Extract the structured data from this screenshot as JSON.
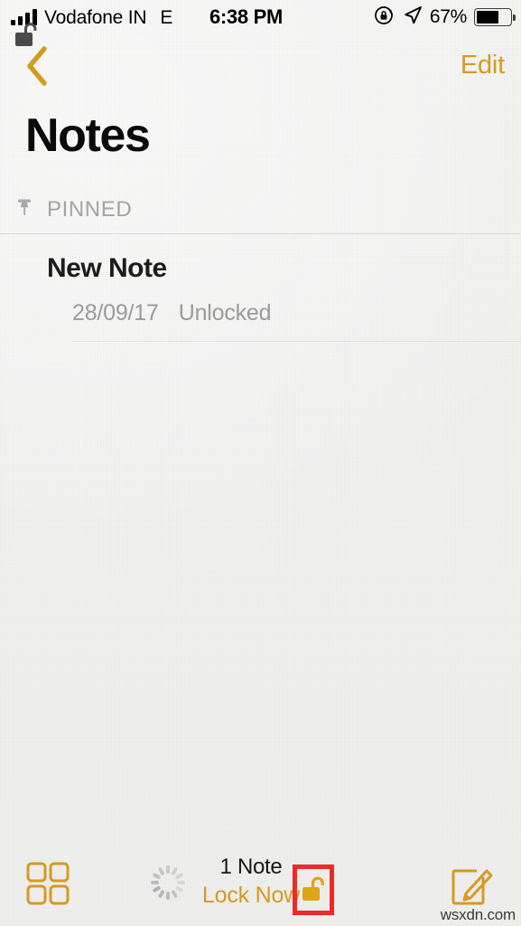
{
  "status_bar": {
    "carrier": "Vodafone IN",
    "network_type": "E",
    "signal_bars": 4,
    "time": "6:38 PM",
    "battery_percent": "67%",
    "battery_level": 67,
    "icons": [
      "signal-bars-icon",
      "rotation-lock-icon",
      "location-arrow-icon",
      "battery-icon"
    ]
  },
  "nav_bar": {
    "back_icon": "chevron-left-icon",
    "edit_label": "Edit"
  },
  "header": {
    "title": "Notes"
  },
  "sections": [
    {
      "icon": "pin-icon",
      "label": "PINNED",
      "notes": [
        {
          "icon": "unlock-icon",
          "title": "New Note",
          "date": "28/09/17",
          "status": "Unlocked"
        }
      ]
    }
  ],
  "toolbar": {
    "gallery_icon": "grid-view-icon",
    "spinner_icon": "activity-spinner-icon",
    "note_count": "1 Note",
    "lock_now_label": "Lock Now",
    "unlock_icon": "unlock-padlock-icon",
    "compose_icon": "compose-note-icon"
  },
  "annotation": {
    "highlight_color": "#ee2a24",
    "highlight_target": "unlock-padlock-icon"
  },
  "watermark": {
    "text": "wsxdn.com"
  },
  "colors": {
    "accent": "#d79a20",
    "background": "#f2f2f1",
    "title": "#0a0a0a",
    "muted": "#9b9b9b",
    "highlight": "#ee2a24"
  }
}
